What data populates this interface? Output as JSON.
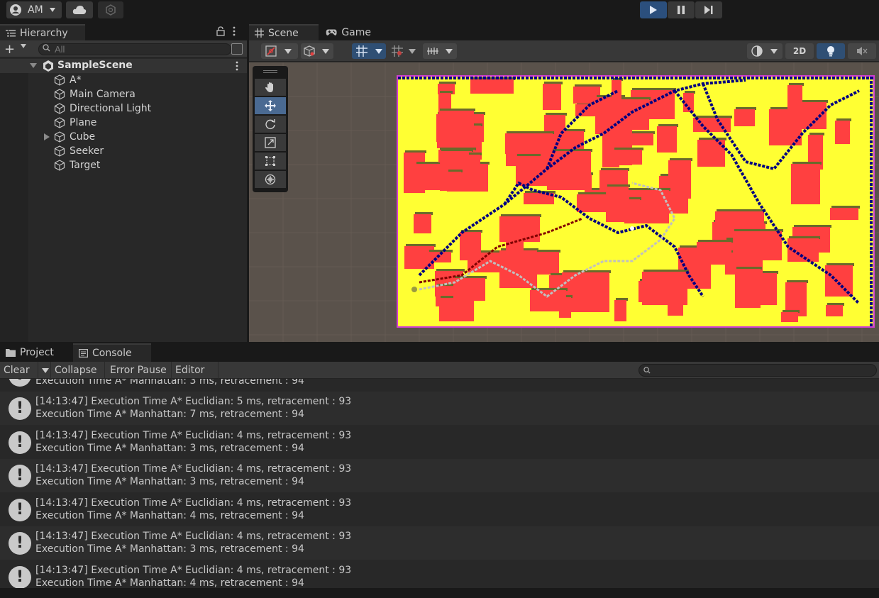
{
  "toolbar": {
    "account_label": "AM",
    "icons": [
      "account-icon",
      "caret-down-icon",
      "cloud-icon",
      "collab-icon",
      "play-icon",
      "pause-icon",
      "step-icon"
    ],
    "play_active_color": "#2b4f7d"
  },
  "hierarchy": {
    "tab_label": "Hierarchy",
    "search_placeholder": "All",
    "scene_name": "SampleScene",
    "items": [
      {
        "label": "A*",
        "expandable": false
      },
      {
        "label": "Main Camera",
        "expandable": false
      },
      {
        "label": "Directional Light",
        "expandable": false
      },
      {
        "label": "Plane",
        "expandable": false
      },
      {
        "label": "Cube",
        "expandable": true
      },
      {
        "label": "Seeker",
        "expandable": false
      },
      {
        "label": "Target",
        "expandable": false
      }
    ]
  },
  "scene": {
    "scene_tab_label": "Scene",
    "game_tab_label": "Game",
    "mode_2d_label": "2D",
    "grid_colors": {
      "ground": "#ffff33",
      "obstacle": "#ff4040",
      "path": "#000080",
      "route": "#c0c0c0"
    }
  },
  "bottom": {
    "project_tab_label": "Project",
    "console_tab_label": "Console",
    "clear_label": "Clear",
    "collapse_label": "Collapse",
    "error_pause_label": "Error Pause",
    "editor_label": "Editor"
  },
  "console": {
    "partial_top": "Execution Time A* Manhattan: 3 ms, retracement : 94",
    "logs": [
      {
        "line1": "[14:13:47] Execution Time A* Euclidian: 5 ms, retracement : 93",
        "line2": "Execution Time A* Manhattan: 7 ms, retracement : 94"
      },
      {
        "line1": "[14:13:47] Execution Time A* Euclidian: 4 ms, retracement : 93",
        "line2": "Execution Time A* Manhattan: 3 ms, retracement : 94"
      },
      {
        "line1": "[14:13:47] Execution Time A* Euclidian: 4 ms, retracement : 93",
        "line2": "Execution Time A* Manhattan: 3 ms, retracement : 94"
      },
      {
        "line1": "[14:13:47] Execution Time A* Euclidian: 4 ms, retracement : 93",
        "line2": "Execution Time A* Manhattan: 4 ms, retracement : 94"
      },
      {
        "line1": "[14:13:47] Execution Time A* Euclidian: 4 ms, retracement : 93",
        "line2": "Execution Time A* Manhattan: 3 ms, retracement : 94"
      },
      {
        "line1": "[14:13:47] Execution Time A* Euclidian: 4 ms, retracement : 93",
        "line2": "Execution Time A* Manhattan: 4 ms, retracement : 94"
      }
    ]
  }
}
